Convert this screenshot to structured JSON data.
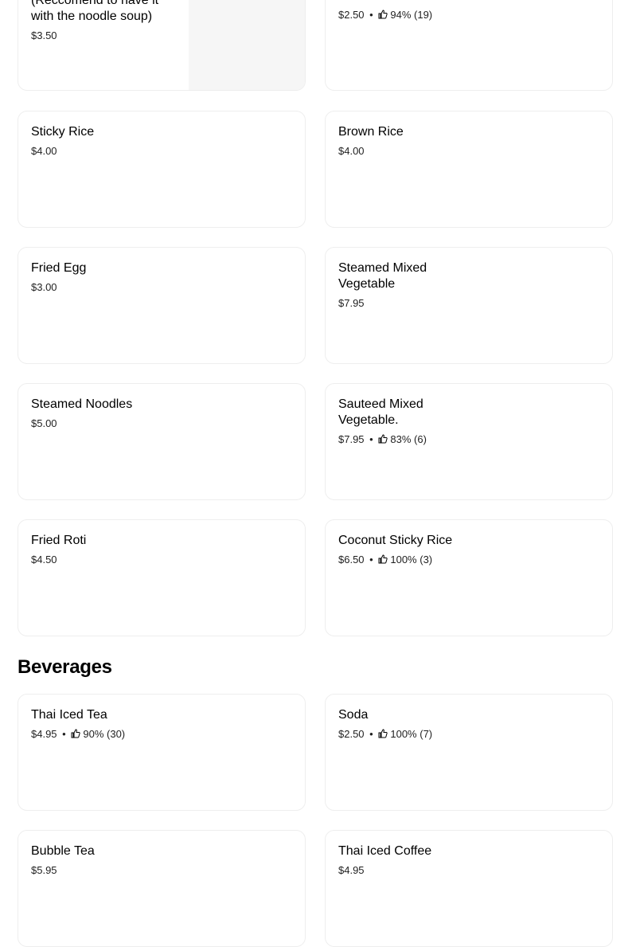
{
  "colors": {
    "text": "#000000",
    "card_border": "#eeeeee",
    "image_placeholder": "#f6f6f6"
  },
  "menu": {
    "top_left": {
      "name": "(Reccomend to have it with the noodle soup)",
      "price": "$3.50"
    },
    "top_right": {
      "price": "$2.50",
      "separator": "•",
      "rating": "94%",
      "count": "(19)",
      "icon": "thumbs-up-icon"
    },
    "items": [
      {
        "name": "Sticky Rice",
        "price": "$4.00"
      },
      {
        "name": "Brown Rice",
        "price": "$4.00"
      },
      {
        "name": "Fried Egg",
        "price": "$3.00"
      },
      {
        "name": "Steamed Mixed Vegetable",
        "price": "$7.95"
      },
      {
        "name": "Steamed Noodles",
        "price": "$5.00"
      },
      {
        "name": "Sauteed Mixed Vegetable.",
        "price": "$7.95",
        "separator": "•",
        "rating": "83%",
        "count": "(6)"
      },
      {
        "name": "Fried Roti",
        "price": "$4.50"
      },
      {
        "name": "Coconut Sticky Rice",
        "price": "$6.50",
        "separator": "•",
        "rating": "100%",
        "count": "(3)"
      }
    ]
  },
  "beverages": {
    "title": "Beverages",
    "items": [
      {
        "name": "Thai Iced Tea",
        "price": "$4.95",
        "separator": "•",
        "rating": "90%",
        "count": "(30)"
      },
      {
        "name": "Soda",
        "price": "$2.50",
        "separator": "•",
        "rating": "100%",
        "count": "(7)"
      },
      {
        "name": "Bubble Tea",
        "price": "$5.95"
      },
      {
        "name": "Thai Iced Coffee",
        "price": "$4.95"
      }
    ]
  }
}
